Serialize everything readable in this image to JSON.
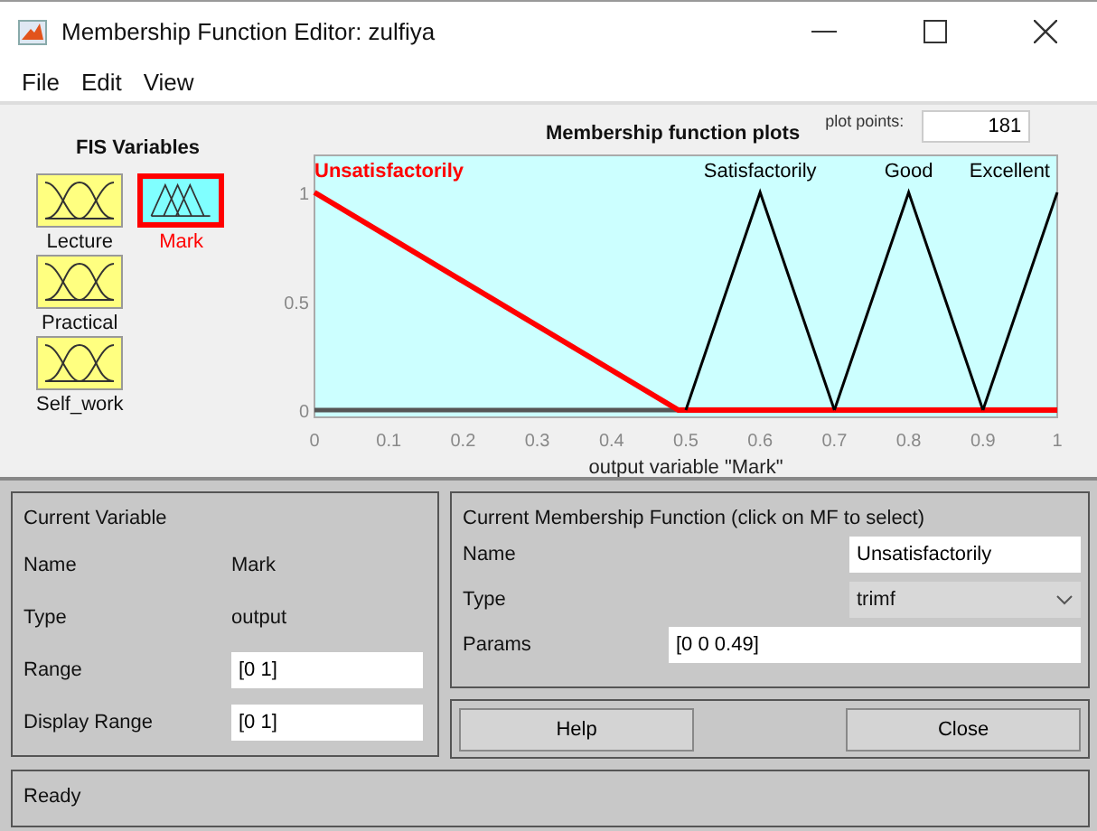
{
  "window": {
    "title": "Membership Function Editor: zulfiya"
  },
  "menu": [
    "File",
    "Edit",
    "View"
  ],
  "fis_variables": {
    "title": "FIS Variables",
    "items": [
      {
        "name": "Lecture",
        "kind": "input",
        "selected": false
      },
      {
        "name": "Mark",
        "kind": "output",
        "selected": true
      },
      {
        "name": "Practical",
        "kind": "input",
        "selected": false
      },
      {
        "name": "Self_work",
        "kind": "input",
        "selected": false
      }
    ]
  },
  "plot": {
    "title": "Membership function plots",
    "plot_points_label": "plot points:",
    "plot_points": "181",
    "chart_data": {
      "type": "line",
      "xlabel": "output variable \"Mark\"",
      "x": [
        0,
        0.49,
        0.5,
        0.6,
        0.7,
        0.8,
        0.9,
        1
      ],
      "series": [
        {
          "name": "Unsatisfactorily",
          "color": "#ff0000",
          "values": [
            1,
            0,
            0,
            0,
            0,
            0,
            0,
            0
          ]
        },
        {
          "name": "Satisfactorily",
          "color": "#000000",
          "values": [
            null,
            null,
            0,
            1,
            0,
            null,
            null,
            null
          ]
        },
        {
          "name": "Good",
          "color": "#000000",
          "values": [
            null,
            null,
            null,
            null,
            0,
            1,
            0,
            null
          ]
        },
        {
          "name": "Excellent",
          "color": "#000000",
          "values": [
            null,
            null,
            null,
            null,
            null,
            null,
            0,
            1
          ]
        }
      ],
      "xlim": [
        0,
        1
      ],
      "ylim": [
        -0.033,
        1.17
      ],
      "xticks": [
        0,
        0.1,
        0.2,
        0.3,
        0.4,
        0.5,
        0.6,
        0.7,
        0.8,
        0.9,
        1
      ],
      "yticks": [
        0,
        0.5,
        1
      ]
    }
  },
  "current_variable": {
    "title": "Current Variable",
    "name_label": "Name",
    "name": "Mark",
    "type_label": "Type",
    "type": "output",
    "range_label": "Range",
    "range": "[0 1]",
    "display_range_label": "Display Range",
    "display_range": "[0 1]"
  },
  "current_mf": {
    "title": "Current Membership Function (click on MF to select)",
    "name_label": "Name",
    "name": "Unsatisfactorily",
    "type_label": "Type",
    "type": "trimf",
    "params_label": "Params",
    "params": "[0 0 0.49]"
  },
  "buttons": [
    "Help",
    "Close"
  ],
  "status_bar": "Ready"
}
